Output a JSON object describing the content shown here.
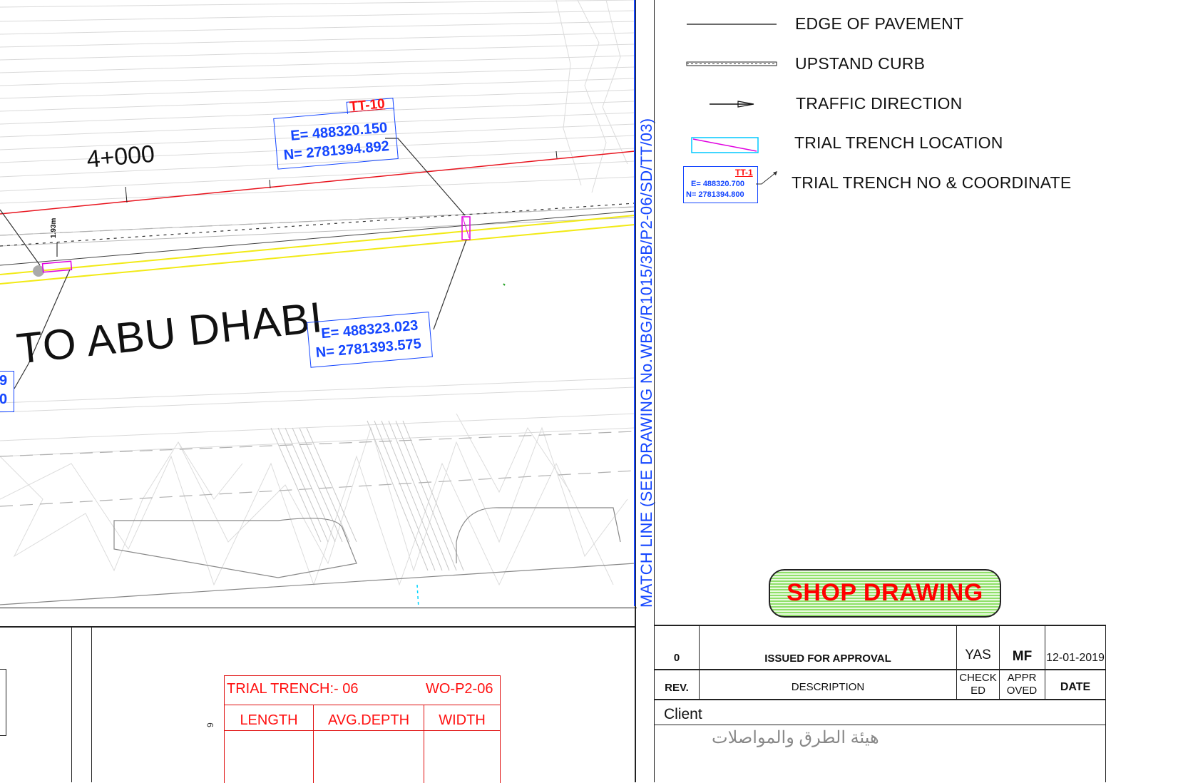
{
  "drawing": {
    "chainage": "4+000",
    "direction_text": "TO ABU DHABI",
    "offset_dim": "1.93m",
    "match_line": "MATCH LINE (SEE DRAWING No.WBG/R1015/3B/P2-06/SD/TT/03)",
    "tt10": {
      "id": "TT-10",
      "e": "E= 488320.150",
      "n": "N= 2781394.892"
    },
    "tt_other": {
      "e": "E= 488323.023",
      "n": "N= 2781393.575"
    },
    "edge_fragment": {
      "e": "9",
      "n": "0"
    },
    "colors": {
      "coordinate_text": "#1446ff",
      "red_line": "#e8141e",
      "yellow_line": "#f2ea16",
      "cyan": "#00d5ff",
      "magenta": "#e000e0"
    }
  },
  "legend": {
    "items": [
      {
        "label": "EDGE OF PAVEMENT",
        "symbol": "thin-line"
      },
      {
        "label": "UPSTAND CURB",
        "symbol": "hatched-line"
      },
      {
        "label": "TRAFFIC DIRECTION",
        "symbol": "arrow"
      },
      {
        "label": "TRIAL TRENCH LOCATION",
        "symbol": "trench-box"
      },
      {
        "label": "TRIAL TRENCH NO & COORDINATE",
        "symbol": "coordinate-box"
      }
    ],
    "sample": {
      "id": "TT-1",
      "e": "E= 488320.700",
      "n": "N= 2781394.800"
    }
  },
  "stamp": {
    "text": "SHOP DRAWING",
    "fill": "#88e060",
    "text_color": "#ff0000"
  },
  "revision_table": {
    "rev": "0",
    "description": "ISSUED FOR APPROVAL",
    "checked": "YAS",
    "approved": "MF",
    "date": "12-01-2019",
    "headers": {
      "rev": "REV.",
      "description": "DESCRIPTION",
      "checked": "CHECK ED",
      "approved": "APPR OVED",
      "date": "DATE"
    },
    "client_label": "Client",
    "client_arabic": "هيئة الطرق والمواصلات"
  },
  "trench_table": {
    "title": "TRIAL TRENCH:- 06",
    "work_order": "WO-P2-06",
    "columns": [
      "LENGTH",
      "AVG.DEPTH",
      "WIDTH"
    ]
  },
  "side_fragment": "9"
}
